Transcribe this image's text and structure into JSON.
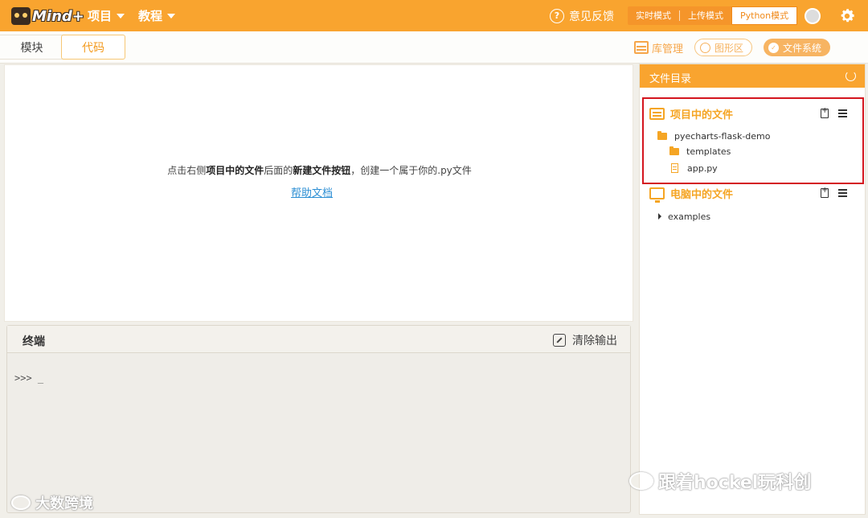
{
  "app": {
    "logo_text": "Mind+",
    "menu": [
      {
        "label": "项目"
      },
      {
        "label": "教程"
      }
    ],
    "feedback_label": "意见反馈",
    "modes": [
      "实时模式",
      "上传模式",
      "Python模式"
    ],
    "active_mode": "Python模式"
  },
  "tabs": {
    "blocks": "模块",
    "code": "代码",
    "active": "代码"
  },
  "toolbar": {
    "lib_label": "库管理",
    "graph_label": "图形区",
    "fs_label": "文件系统"
  },
  "editor": {
    "hint_part1": "点击右侧",
    "hint_bold1": "项目中的文件",
    "hint_part2": "后面的",
    "hint_bold2": "新建文件按钮",
    "hint_part3": "，创建一个属于你的.py文件",
    "help_link": "帮助文档"
  },
  "terminal": {
    "title": "终端",
    "clear_label": "清除输出",
    "prompt": ">>> _"
  },
  "file_panel": {
    "title": "文件目录",
    "project_section": "项目中的文件",
    "project_tree": [
      {
        "type": "folder",
        "name": "pyecharts-flask-demo"
      },
      {
        "type": "folder",
        "name": "templates"
      },
      {
        "type": "file",
        "name": "app.py"
      }
    ],
    "computer_section": "电脑中的文件",
    "computer_tree": [
      {
        "type": "collapsed-folder",
        "name": "examples"
      }
    ]
  },
  "watermarks": {
    "left": "大数跨境",
    "right": "跟着hockel玩科创"
  },
  "colors": {
    "accent": "#f9a42f",
    "highlight_box": "#d4161f",
    "link": "#2e8fd4"
  }
}
